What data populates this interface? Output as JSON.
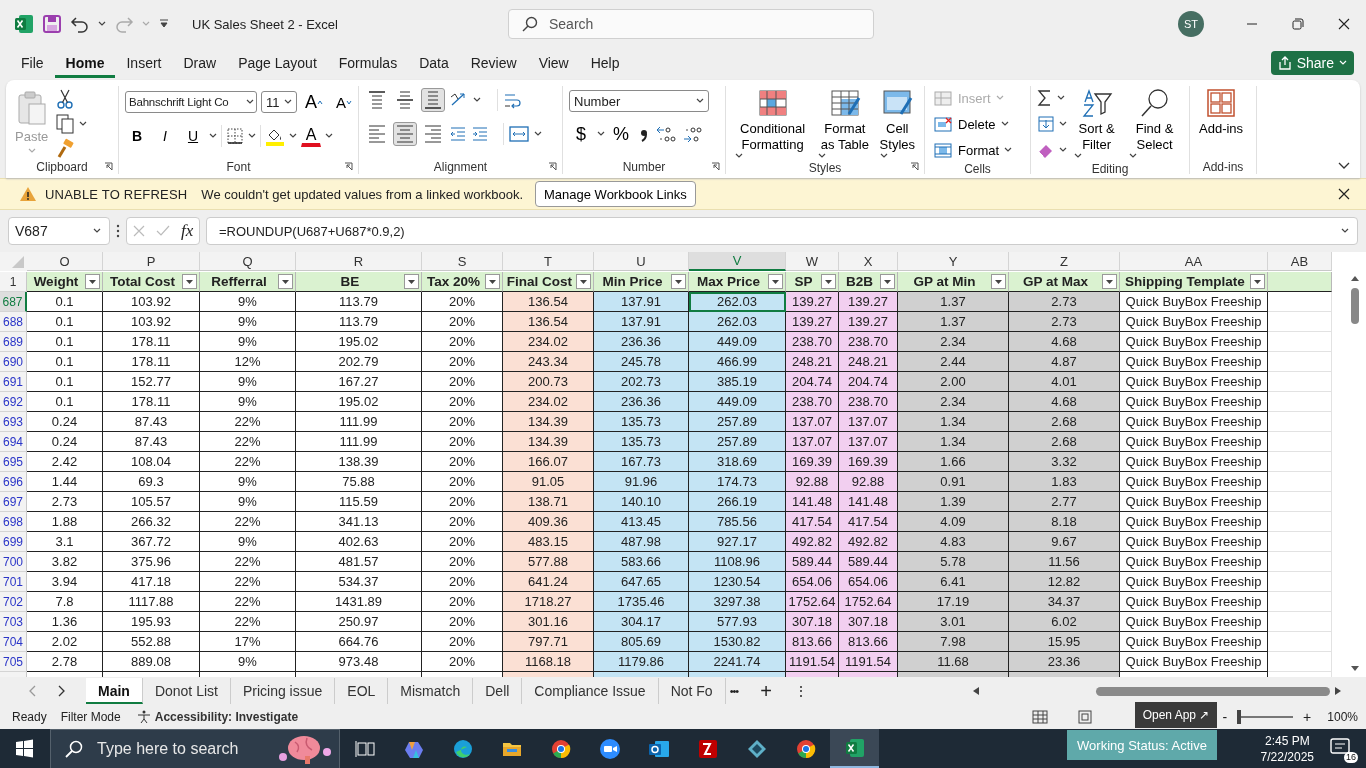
{
  "title_bar": {
    "title": "UK Sales Sheet 2  -  Excel",
    "search_placeholder": "Search",
    "avatar": "ST"
  },
  "menu": {
    "tabs": [
      {
        "label": "File",
        "selected": false
      },
      {
        "label": "Home",
        "selected": true
      },
      {
        "label": "Insert",
        "selected": false
      },
      {
        "label": "Draw",
        "selected": false
      },
      {
        "label": "Page Layout",
        "selected": false
      },
      {
        "label": "Formulas",
        "selected": false
      },
      {
        "label": "Data",
        "selected": false
      },
      {
        "label": "Review",
        "selected": false
      },
      {
        "label": "View",
        "selected": false
      },
      {
        "label": "Help",
        "selected": false
      }
    ],
    "share": "Share"
  },
  "ribbon": {
    "clipboard": {
      "label": "Clipboard",
      "paste": "Paste"
    },
    "font": {
      "label": "Font",
      "font_name": "Bahnschrift Light Co",
      "font_size": "11",
      "grow": "A",
      "shrink": "A",
      "bold": "B",
      "italic": "I",
      "underline": "U",
      "font_color": "A"
    },
    "alignment": {
      "label": "Alignment",
      "vertical": [
        {
          "kind": "top",
          "selected": false
        },
        {
          "kind": "middle",
          "selected": false
        },
        {
          "kind": "bottom",
          "selected": true
        }
      ],
      "horizontal": [
        {
          "kind": "left",
          "selected": false
        },
        {
          "kind": "center",
          "selected": true
        },
        {
          "kind": "right",
          "selected": false
        }
      ]
    },
    "number": {
      "label": "Number",
      "format": "Number",
      "currency": "$",
      "percent": "%"
    },
    "styles": {
      "label": "Styles",
      "buttons": [
        {
          "kind": "conditional",
          "label": "Conditional Formatting"
        },
        {
          "kind": "table",
          "label": "Format as Table"
        },
        {
          "kind": "cell",
          "label": "Cell Styles"
        }
      ]
    },
    "cells": {
      "label": "Cells",
      "items": [
        {
          "kind": "insert",
          "label": "Insert",
          "disabled": true
        },
        {
          "kind": "delete",
          "label": "Delete",
          "disabled": false
        },
        {
          "kind": "format",
          "label": "Format",
          "disabled": false
        }
      ]
    },
    "editing": {
      "label": "Editing",
      "sort": "Sort & Filter",
      "find": "Find & Select"
    },
    "addins": {
      "label": "Add-ins",
      "button": "Add-ins"
    }
  },
  "message_bar": {
    "title": "UNABLE TO REFRESH",
    "text": "We couldn't get updated values from a linked workbook.",
    "button": "Manage Workbook Links"
  },
  "formula_bar": {
    "name_box": "V687",
    "fx": "fx",
    "formula": "=ROUNDUP(U687+U687*0.9,2)"
  },
  "grid": {
    "header_row": "1",
    "columns": [
      {
        "letter": "O",
        "header": "Weight",
        "selected": false
      },
      {
        "letter": "P",
        "header": "Total Cost",
        "selected": false
      },
      {
        "letter": "Q",
        "header": "Refferral",
        "selected": false
      },
      {
        "letter": "R",
        "header": "BE",
        "selected": false
      },
      {
        "letter": "S",
        "header": "Tax 20%",
        "selected": false
      },
      {
        "letter": "T",
        "header": "Final Cost",
        "selected": false,
        "color": "#fbe0d4"
      },
      {
        "letter": "U",
        "header": "Min Price",
        "selected": false,
        "color": "#c4e4f4"
      },
      {
        "letter": "V",
        "header": "Max Price",
        "selected": true,
        "color": "#c4e4f4"
      },
      {
        "letter": "W",
        "header": "SP",
        "selected": false,
        "color": "#f2cff0"
      },
      {
        "letter": "X",
        "header": "B2B",
        "selected": false,
        "color": "#f2cff0"
      },
      {
        "letter": "Y",
        "header": "GP at Min",
        "selected": false,
        "color": "#d0d0d0"
      },
      {
        "letter": "Z",
        "header": "GP at Max",
        "selected": false,
        "color": "#d0d0d0"
      },
      {
        "letter": "AA",
        "header": "Shipping Template",
        "selected": false
      },
      {
        "letter": "AB",
        "selected": false
      }
    ],
    "rows": [
      {
        "number": "687",
        "selected": true,
        "cells": [
          "0.1",
          "103.92",
          "9%",
          "113.79",
          "20%",
          "136.54",
          "137.91",
          "262.03",
          "139.27",
          "139.27",
          "1.37",
          "2.73",
          "Quick BuyBox Freeship"
        ]
      },
      {
        "number": "688",
        "selected": false,
        "cells": [
          "0.1",
          "103.92",
          "9%",
          "113.79",
          "20%",
          "136.54",
          "137.91",
          "262.03",
          "139.27",
          "139.27",
          "1.37",
          "2.73",
          "Quick BuyBox Freeship"
        ]
      },
      {
        "number": "689",
        "selected": false,
        "cells": [
          "0.1",
          "178.11",
          "9%",
          "195.02",
          "20%",
          "234.02",
          "236.36",
          "449.09",
          "238.70",
          "238.70",
          "2.34",
          "4.68",
          "Quick BuyBox Freeship"
        ]
      },
      {
        "number": "690",
        "selected": false,
        "cells": [
          "0.1",
          "178.11",
          "12%",
          "202.79",
          "20%",
          "243.34",
          "245.78",
          "466.99",
          "248.21",
          "248.21",
          "2.44",
          "4.87",
          "Quick BuyBox Freeship"
        ]
      },
      {
        "number": "691",
        "selected": false,
        "cells": [
          "0.1",
          "152.77",
          "9%",
          "167.27",
          "20%",
          "200.73",
          "202.73",
          "385.19",
          "204.74",
          "204.74",
          "2.00",
          "4.01",
          "Quick BuyBox Freeship"
        ]
      },
      {
        "number": "692",
        "selected": false,
        "cells": [
          "0.1",
          "178.11",
          "9%",
          "195.02",
          "20%",
          "234.02",
          "236.36",
          "449.09",
          "238.70",
          "238.70",
          "2.34",
          "4.68",
          "Quick BuyBox Freeship"
        ]
      },
      {
        "number": "693",
        "selected": false,
        "cells": [
          "0.24",
          "87.43",
          "22%",
          "111.99",
          "20%",
          "134.39",
          "135.73",
          "257.89",
          "137.07",
          "137.07",
          "1.34",
          "2.68",
          "Quick BuyBox Freeship"
        ]
      },
      {
        "number": "694",
        "selected": false,
        "cells": [
          "0.24",
          "87.43",
          "22%",
          "111.99",
          "20%",
          "134.39",
          "135.73",
          "257.89",
          "137.07",
          "137.07",
          "1.34",
          "2.68",
          "Quick BuyBox Freeship"
        ]
      },
      {
        "number": "695",
        "selected": false,
        "cells": [
          "2.42",
          "108.04",
          "22%",
          "138.39",
          "20%",
          "166.07",
          "167.73",
          "318.69",
          "169.39",
          "169.39",
          "1.66",
          "3.32",
          "Quick BuyBox Freeship"
        ]
      },
      {
        "number": "696",
        "selected": false,
        "cells": [
          "1.44",
          "69.3",
          "9%",
          "75.88",
          "20%",
          "91.05",
          "91.96",
          "174.73",
          "92.88",
          "92.88",
          "0.91",
          "1.83",
          "Quick BuyBox Freeship"
        ]
      },
      {
        "number": "697",
        "selected": false,
        "cells": [
          "2.73",
          "105.57",
          "9%",
          "115.59",
          "20%",
          "138.71",
          "140.10",
          "266.19",
          "141.48",
          "141.48",
          "1.39",
          "2.77",
          "Quick BuyBox Freeship"
        ]
      },
      {
        "number": "698",
        "selected": false,
        "cells": [
          "1.88",
          "266.32",
          "22%",
          "341.13",
          "20%",
          "409.36",
          "413.45",
          "785.56",
          "417.54",
          "417.54",
          "4.09",
          "8.18",
          "Quick BuyBox Freeship"
        ]
      },
      {
        "number": "699",
        "selected": false,
        "cells": [
          "3.1",
          "367.72",
          "9%",
          "402.63",
          "20%",
          "483.15",
          "487.98",
          "927.17",
          "492.82",
          "492.82",
          "4.83",
          "9.67",
          "Quick BuyBox Freeship"
        ]
      },
      {
        "number": "700",
        "selected": false,
        "cells": [
          "3.82",
          "375.96",
          "22%",
          "481.57",
          "20%",
          "577.88",
          "583.66",
          "1108.96",
          "589.44",
          "589.44",
          "5.78",
          "11.56",
          "Quick BuyBox Freeship"
        ]
      },
      {
        "number": "701",
        "selected": false,
        "cells": [
          "3.94",
          "417.18",
          "22%",
          "534.37",
          "20%",
          "641.24",
          "647.65",
          "1230.54",
          "654.06",
          "654.06",
          "6.41",
          "12.82",
          "Quick BuyBox Freeship"
        ]
      },
      {
        "number": "702",
        "selected": false,
        "cells": [
          "7.8",
          "1117.88",
          "22%",
          "1431.89",
          "20%",
          "1718.27",
          "1735.46",
          "3297.38",
          "1752.64",
          "1752.64",
          "17.19",
          "34.37",
          "Quick BuyBox Freeship"
        ]
      },
      {
        "number": "703",
        "selected": false,
        "cells": [
          "1.36",
          "195.93",
          "22%",
          "250.97",
          "20%",
          "301.16",
          "304.17",
          "577.93",
          "307.18",
          "307.18",
          "3.01",
          "6.02",
          "Quick BuyBox Freeship"
        ]
      },
      {
        "number": "704",
        "selected": false,
        "cells": [
          "2.02",
          "552.88",
          "17%",
          "664.76",
          "20%",
          "797.71",
          "805.69",
          "1530.82",
          "813.66",
          "813.66",
          "7.98",
          "15.95",
          "Quick BuyBox Freeship"
        ]
      },
      {
        "number": "705",
        "selected": false,
        "cells": [
          "2.78",
          "889.08",
          "9%",
          "973.48",
          "20%",
          "1168.18",
          "1179.86",
          "2241.74",
          "1191.54",
          "1191.54",
          "11.68",
          "23.36",
          "Quick BuyBox Freeship"
        ]
      }
    ]
  },
  "sheet_tabs": {
    "tabs": [
      {
        "label": "Main",
        "selected": true
      },
      {
        "label": "Donot List",
        "selected": false
      },
      {
        "label": "Pricing issue",
        "selected": false
      },
      {
        "label": "EOL",
        "selected": false
      },
      {
        "label": "Mismatch",
        "selected": false
      },
      {
        "label": "Dell",
        "selected": false
      },
      {
        "label": "Compliance Issue",
        "selected": false
      },
      {
        "label": "Not Fo",
        "selected": false
      }
    ],
    "more": "•••",
    "add": "+",
    "options": "⋮"
  },
  "status_bar": {
    "ready": "Ready",
    "filter": "Filter Mode",
    "accessibility": "Accessibility: Investigate",
    "zoom": "100%",
    "zoom_out": "-",
    "zoom_in": "+"
  },
  "floating_widget": {
    "open_app": "Open App ↗",
    "status": "Working Status: Active"
  },
  "taskbar": {
    "search_placeholder": "Type here to search",
    "apps": [
      {
        "kind": "taskview",
        "active": false
      },
      {
        "kind": "copilot",
        "active": false
      },
      {
        "kind": "edge",
        "active": false
      },
      {
        "kind": "explorer",
        "active": false
      },
      {
        "kind": "chrome",
        "active": false
      },
      {
        "kind": "zoom",
        "active": false
      },
      {
        "kind": "outlook",
        "active": false
      },
      {
        "kind": "filezilla",
        "active": false
      },
      {
        "kind": "diamond",
        "active": false
      },
      {
        "kind": "chrome",
        "active": false
      },
      {
        "kind": "excel",
        "active": true
      }
    ],
    "time": "2:45 PM",
    "date": "7/22/2025",
    "notifications": "16"
  }
}
